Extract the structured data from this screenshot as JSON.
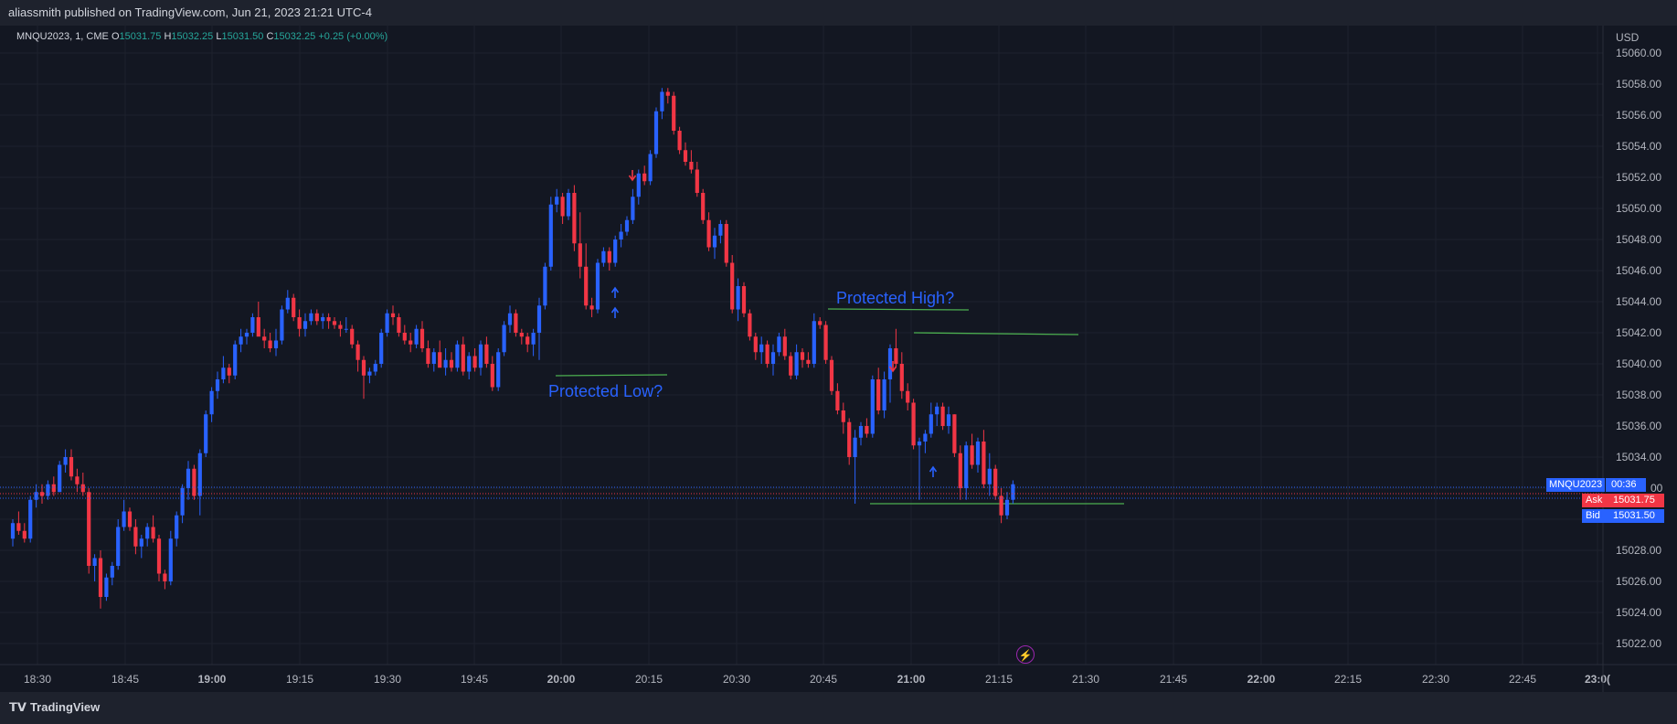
{
  "header": {
    "published": "aliassmith published on TradingView.com, Jun 21, 2023 21:21 UTC-4"
  },
  "legend": {
    "symbol": "MNQU2023, 1, CME",
    "o_label": "O",
    "o_value": "15031.75",
    "h_label": "H",
    "h_value": "15032.25",
    "l_label": "L",
    "l_value": "15031.50",
    "c_label": "C",
    "c_value": "15032.25",
    "change": "+0.25 (+0.00%)"
  },
  "price_axis": {
    "currency": "USD",
    "ticks": [
      "15060.00",
      "15058.00",
      "15056.00",
      "15054.00",
      "15052.00",
      "15050.00",
      "15048.00",
      "15046.00",
      "15044.00",
      "15042.00",
      "15040.00",
      "15038.00",
      "15036.00",
      "15034.00",
      "15028.00",
      "15026.00",
      "15024.00",
      "15022.00"
    ],
    "partial_tick": "00"
  },
  "price_tags": {
    "symbol": "MNQU2023",
    "countdown": "00:36",
    "ask_label": "Ask",
    "ask_value": "15031.75",
    "bid_label": "Bid",
    "bid_value": "15031.50"
  },
  "time_axis": {
    "ticks": [
      "18:30",
      "18:45",
      "19:00",
      "19:15",
      "19:30",
      "19:45",
      "20:00",
      "20:15",
      "20:30",
      "20:45",
      "21:00",
      "21:15",
      "21:30",
      "21:45",
      "22:00",
      "22:15",
      "22:30",
      "22:45",
      "23:0("
    ]
  },
  "annotations": {
    "low": "Protected Low?",
    "high": "Protected High?"
  },
  "footer": {
    "brand": "TradingView"
  },
  "colors": {
    "up": "#2962ff",
    "down": "#f23645",
    "line": "#4caf50",
    "bg": "#131722",
    "grid": "#1e222d"
  },
  "chart_data": {
    "type": "candlestick",
    "symbol": "MNQU2023",
    "interval": "1",
    "ylim": [
      15021,
      15061
    ],
    "x_start": "18:24",
    "candles": [
      [
        15028.75,
        15030.0,
        15028.25,
        15029.75
      ],
      [
        15029.75,
        15030.5,
        15029.0,
        15029.25
      ],
      [
        15029.25,
        15029.75,
        15028.5,
        15028.75
      ],
      [
        15028.75,
        15031.5,
        15028.5,
        15031.25
      ],
      [
        15031.25,
        15032.25,
        15030.75,
        15031.75
      ],
      [
        15031.75,
        15032.25,
        15031.0,
        15031.5
      ],
      [
        15031.5,
        15032.5,
        15031.25,
        15032.25
      ],
      [
        15032.25,
        15032.75,
        15031.5,
        15031.75
      ],
      [
        15031.75,
        15033.75,
        15031.75,
        15033.5
      ],
      [
        15033.5,
        15034.5,
        15033.0,
        15034.0
      ],
      [
        15034.0,
        15034.5,
        15032.5,
        15032.75
      ],
      [
        15032.75,
        15033.25,
        15031.75,
        15032.25
      ],
      [
        15032.25,
        15033.0,
        15031.5,
        15031.75
      ],
      [
        15031.75,
        15032.0,
        15026.5,
        15027.0
      ],
      [
        15027.0,
        15027.75,
        15026.0,
        15027.5
      ],
      [
        15027.5,
        15028.0,
        15024.25,
        15025.0
      ],
      [
        15025.0,
        15026.5,
        15024.75,
        15026.25
      ],
      [
        15026.25,
        15027.25,
        15025.75,
        15027.0
      ],
      [
        15027.0,
        15030.0,
        15026.75,
        15029.5
      ],
      [
        15029.5,
        15031.25,
        15029.25,
        15030.5
      ],
      [
        15030.5,
        15030.75,
        15029.25,
        15029.5
      ],
      [
        15029.5,
        15030.0,
        15027.75,
        15028.25
      ],
      [
        15028.25,
        15029.0,
        15027.5,
        15028.75
      ],
      [
        15028.75,
        15029.75,
        15028.25,
        15029.5
      ],
      [
        15029.5,
        15030.25,
        15028.5,
        15028.75
      ],
      [
        15028.75,
        15029.0,
        15026.0,
        15026.5
      ],
      [
        15026.5,
        15026.75,
        15025.5,
        15026.0
      ],
      [
        15026.0,
        15029.25,
        15025.75,
        15028.75
      ],
      [
        15028.75,
        15030.5,
        15028.25,
        15030.25
      ],
      [
        15030.25,
        15032.25,
        15029.75,
        15032.0
      ],
      [
        15032.0,
        15033.75,
        15031.25,
        15033.25
      ],
      [
        15033.25,
        15033.5,
        15031.25,
        15031.5
      ],
      [
        15031.5,
        15034.5,
        15030.25,
        15034.25
      ],
      [
        15034.25,
        15037.0,
        15034.0,
        15036.75
      ],
      [
        15036.75,
        15038.5,
        15036.25,
        15038.25
      ],
      [
        15038.25,
        15039.5,
        15037.75,
        15039.0
      ],
      [
        15039.0,
        15040.5,
        15038.75,
        15039.75
      ],
      [
        15039.75,
        15040.0,
        15038.75,
        15039.25
      ],
      [
        15039.25,
        15041.5,
        15039.0,
        15041.25
      ],
      [
        15041.25,
        15042.25,
        15040.75,
        15041.75
      ],
      [
        15041.75,
        15042.25,
        15041.25,
        15042.0
      ],
      [
        15042.0,
        15043.25,
        15041.75,
        15043.0
      ],
      [
        15043.0,
        15044.0,
        15042.5,
        15041.75
      ],
      [
        15041.75,
        15042.25,
        15041.0,
        15041.5
      ],
      [
        15041.5,
        15042.0,
        15040.75,
        15041.0
      ],
      [
        15041.0,
        15042.25,
        15040.5,
        15041.5
      ],
      [
        15041.5,
        15043.75,
        15041.25,
        15043.5
      ],
      [
        15043.5,
        15044.75,
        15043.25,
        15044.25
      ],
      [
        15044.25,
        15044.5,
        15042.75,
        15043.0
      ],
      [
        15043.0,
        15043.5,
        15041.75,
        15042.25
      ],
      [
        15042.25,
        15043.25,
        15041.75,
        15042.75
      ],
      [
        15042.75,
        15043.5,
        15042.5,
        15043.25
      ],
      [
        15043.25,
        15043.5,
        15042.5,
        15042.75
      ],
      [
        15042.75,
        15043.25,
        15042.25,
        15043.0
      ],
      [
        15043.0,
        15043.25,
        15042.25,
        15042.75
      ],
      [
        15042.75,
        15043.0,
        15042.25,
        15042.5
      ],
      [
        15042.5,
        15042.75,
        15041.75,
        15042.25
      ],
      [
        15042.25,
        15043.0,
        15042.0,
        15042.25
      ],
      [
        15042.25,
        15042.5,
        15041.0,
        15041.25
      ],
      [
        15041.25,
        15041.5,
        15039.5,
        15040.25
      ],
      [
        15040.25,
        15040.5,
        15037.75,
        15039.25
      ],
      [
        15039.25,
        15039.75,
        15038.75,
        15039.5
      ],
      [
        15039.5,
        15040.25,
        15039.25,
        15040.0
      ],
      [
        15040.0,
        15042.25,
        15039.75,
        15042.0
      ],
      [
        15042.0,
        15043.5,
        15041.75,
        15043.25
      ],
      [
        15043.25,
        15043.75,
        15042.5,
        15043.0
      ],
      [
        15043.0,
        15043.25,
        15041.75,
        15042.0
      ],
      [
        15042.0,
        15042.5,
        15041.25,
        15041.5
      ],
      [
        15041.5,
        15042.0,
        15040.75,
        15041.25
      ],
      [
        15041.25,
        15042.5,
        15041.0,
        15042.25
      ],
      [
        15042.25,
        15042.75,
        15040.75,
        15041.0
      ],
      [
        15041.0,
        15041.5,
        15039.75,
        15040.0
      ],
      [
        15040.0,
        15041.0,
        15039.5,
        15040.75
      ],
      [
        15040.75,
        15041.5,
        15040.25,
        15039.75
      ],
      [
        15039.75,
        15041.0,
        15039.25,
        15040.25
      ],
      [
        15040.25,
        15040.75,
        15039.5,
        15039.75
      ],
      [
        15039.75,
        15041.5,
        15039.5,
        15041.25
      ],
      [
        15041.25,
        15041.75,
        15039.25,
        15039.5
      ],
      [
        15039.5,
        15040.75,
        15039.0,
        15040.5
      ],
      [
        15040.5,
        15041.0,
        15039.5,
        15039.75
      ],
      [
        15039.75,
        15041.5,
        15039.25,
        15041.25
      ],
      [
        15041.25,
        15041.75,
        15039.75,
        15040.0
      ],
      [
        15040.0,
        15040.5,
        15038.25,
        15038.5
      ],
      [
        15038.5,
        15041.0,
        15038.25,
        15040.75
      ],
      [
        15040.75,
        15042.75,
        15040.5,
        15042.5
      ],
      [
        15042.5,
        15043.75,
        15042.0,
        15043.25
      ],
      [
        15043.25,
        15043.5,
        15041.75,
        15042.0
      ],
      [
        15042.0,
        15042.25,
        15041.25,
        15041.75
      ],
      [
        15041.75,
        15042.0,
        15040.75,
        15041.25
      ],
      [
        15041.25,
        15042.25,
        15040.5,
        15042.0
      ],
      [
        15042.0,
        15044.25,
        15040.25,
        15043.75
      ],
      [
        15043.75,
        15046.5,
        15043.5,
        15046.25
      ],
      [
        15046.25,
        15050.75,
        15046.0,
        15050.25
      ],
      [
        15050.25,
        15051.25,
        15049.75,
        15050.75
      ],
      [
        15050.75,
        15051.0,
        15049.0,
        15049.5
      ],
      [
        15049.5,
        15051.25,
        15049.25,
        15051.0
      ],
      [
        15051.0,
        15051.5,
        15047.25,
        15047.75
      ],
      [
        15047.75,
        15049.75,
        15045.5,
        15046.25
      ],
      [
        15046.25,
        15047.75,
        15043.5,
        15043.75
      ],
      [
        15043.75,
        15044.25,
        15043.0,
        15043.5
      ],
      [
        15043.5,
        15046.75,
        15043.25,
        15046.5
      ],
      [
        15046.5,
        15047.5,
        15046.25,
        15047.25
      ],
      [
        15047.25,
        15047.5,
        15046.0,
        15046.5
      ],
      [
        15046.5,
        15048.25,
        15046.25,
        15048.0
      ],
      [
        15048.0,
        15049.0,
        15047.5,
        15048.5
      ],
      [
        15048.5,
        15049.5,
        15048.25,
        15049.25
      ],
      [
        15049.25,
        15051.25,
        15049.0,
        15050.75
      ],
      [
        15050.75,
        15052.5,
        15050.25,
        15052.25
      ],
      [
        15052.25,
        15052.75,
        15051.5,
        15051.75
      ],
      [
        15051.75,
        15053.75,
        15051.5,
        15053.5
      ],
      [
        15053.5,
        15056.5,
        15053.25,
        15056.25
      ],
      [
        15056.25,
        15057.75,
        15055.75,
        15057.5
      ],
      [
        15057.5,
        15057.75,
        15056.75,
        15057.25
      ],
      [
        15057.25,
        15057.5,
        15054.75,
        15055.0
      ],
      [
        15055.0,
        15055.25,
        15053.5,
        15053.75
      ],
      [
        15053.75,
        15054.25,
        15052.75,
        15053.0
      ],
      [
        15053.0,
        15053.75,
        15052.25,
        15052.5
      ],
      [
        15052.5,
        15053.0,
        15050.75,
        15051.0
      ],
      [
        15051.0,
        15051.25,
        15049.0,
        15049.25
      ],
      [
        15049.25,
        15049.75,
        15047.25,
        15047.5
      ],
      [
        15047.5,
        15048.75,
        15046.75,
        15048.25
      ],
      [
        15048.25,
        15049.25,
        15047.75,
        15049.0
      ],
      [
        15049.0,
        15049.25,
        15046.25,
        15046.5
      ],
      [
        15046.5,
        15047.0,
        15043.25,
        15043.5
      ],
      [
        15043.5,
        15045.5,
        15042.75,
        15045.0
      ],
      [
        15045.0,
        15045.25,
        15043.0,
        15043.25
      ],
      [
        15043.25,
        15043.5,
        15041.5,
        15041.75
      ],
      [
        15041.75,
        15042.0,
        15040.25,
        15040.75
      ],
      [
        15040.75,
        15041.75,
        15040.0,
        15041.25
      ],
      [
        15041.25,
        15041.5,
        15039.75,
        15040.0
      ],
      [
        15040.0,
        15041.25,
        15039.25,
        15040.75
      ],
      [
        15040.75,
        15042.0,
        15040.5,
        15041.75
      ],
      [
        15041.75,
        15042.25,
        15040.25,
        15040.5
      ],
      [
        15040.5,
        15040.75,
        15039.0,
        15039.25
      ],
      [
        15039.25,
        15041.25,
        15039.0,
        15040.75
      ],
      [
        15040.75,
        15041.0,
        15039.75,
        15040.25
      ],
      [
        15040.25,
        15040.75,
        15039.75,
        15040.0
      ],
      [
        15040.0,
        15043.25,
        15039.75,
        15042.75
      ],
      [
        15042.75,
        15043.0,
        15042.25,
        15042.5
      ],
      [
        15042.5,
        15042.75,
        15040.0,
        15040.25
      ],
      [
        15040.25,
        15040.5,
        15038.0,
        15038.25
      ],
      [
        15038.25,
        15038.75,
        15036.75,
        15037.0
      ],
      [
        15037.0,
        15037.5,
        15035.5,
        15036.25
      ],
      [
        15036.25,
        15036.5,
        15033.5,
        15034.0
      ],
      [
        15034.0,
        15035.75,
        15031.0,
        15035.25
      ],
      [
        15035.25,
        15036.25,
        15034.75,
        15036.0
      ],
      [
        15036.0,
        15036.5,
        15035.25,
        15035.5
      ],
      [
        15035.5,
        15039.25,
        15035.25,
        15039.0
      ],
      [
        15039.0,
        15039.75,
        15036.75,
        15037.0
      ],
      [
        15037.0,
        15039.5,
        15036.5,
        15039.0
      ],
      [
        15039.0,
        15041.25,
        15037.5,
        15041.0
      ],
      [
        15041.0,
        15042.25,
        15039.75,
        15040.0
      ],
      [
        15040.0,
        15040.75,
        15037.75,
        15038.25
      ],
      [
        15038.25,
        15038.75,
        15037.0,
        15037.5
      ],
      [
        15037.5,
        15037.75,
        15034.5,
        15034.75
      ],
      [
        15034.75,
        15035.25,
        15031.25,
        15035.0
      ],
      [
        15035.0,
        15035.75,
        15034.25,
        15035.5
      ],
      [
        15035.5,
        15037.5,
        15035.25,
        15036.75
      ],
      [
        15036.75,
        15037.5,
        15036.0,
        15037.25
      ],
      [
        15037.25,
        15037.5,
        15035.75,
        15036.0
      ],
      [
        15036.0,
        15037.25,
        15035.5,
        15036.75
      ],
      [
        15036.75,
        15036.75,
        15034.0,
        15034.25
      ],
      [
        15034.25,
        15034.75,
        15031.25,
        15032.0
      ],
      [
        15032.0,
        15035.0,
        15031.25,
        15034.75
      ],
      [
        15034.75,
        15035.5,
        15033.25,
        15033.5
      ],
      [
        15033.5,
        15035.25,
        15033.0,
        15035.0
      ],
      [
        15035.0,
        15035.75,
        15032.0,
        15032.25
      ],
      [
        15032.25,
        15034.25,
        15031.5,
        15033.25
      ],
      [
        15033.25,
        15033.5,
        15031.25,
        15031.5
      ],
      [
        15031.5,
        15032.0,
        15029.75,
        15030.25
      ],
      [
        15030.25,
        15031.75,
        15030.0,
        15031.25
      ],
      [
        15031.25,
        15032.5,
        15031.0,
        15032.25
      ]
    ],
    "annotations": [
      {
        "label": "Protected Low?",
        "time": "20:00",
        "price": 15040.0
      },
      {
        "label": "Protected High?",
        "time": "20:47",
        "price": 15043.75
      }
    ]
  }
}
